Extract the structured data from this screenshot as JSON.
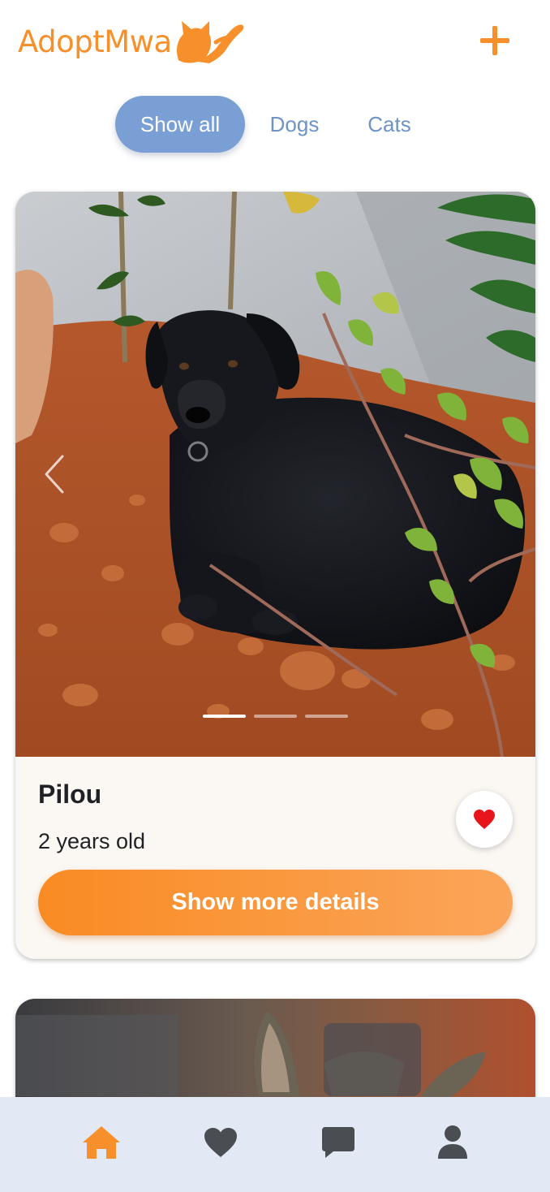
{
  "app": {
    "name": "AdoptMwa",
    "brand_color": "#f7902a",
    "accent_blue": "#7a9fd4"
  },
  "header": {
    "logo_text": "AdoptMwa",
    "logo_icon": "cat-hand-icon",
    "add_icon": "plus-icon"
  },
  "filters": {
    "tabs": [
      {
        "label": "Show all",
        "active": true
      },
      {
        "label": "Dogs",
        "active": false
      },
      {
        "label": "Cats",
        "active": false
      }
    ]
  },
  "cards": [
    {
      "name": "Pilou",
      "age": "2 years old",
      "photo": "black dog lying in red soil",
      "carousel": {
        "count": 3,
        "active_index": 0
      },
      "favorite": true,
      "favorite_icon": "heart-icon",
      "favorite_color": "#e8141c",
      "details_label": "Show more details"
    },
    {
      "photo": "blurred animal ears"
    }
  ],
  "bottom_nav": {
    "items": [
      {
        "icon": "home-icon",
        "active": true
      },
      {
        "icon": "heart-icon",
        "active": false
      },
      {
        "icon": "chat-icon",
        "active": false
      },
      {
        "icon": "user-icon",
        "active": false
      }
    ],
    "active_color": "#f7902a",
    "inactive_color": "#4a4d52"
  }
}
